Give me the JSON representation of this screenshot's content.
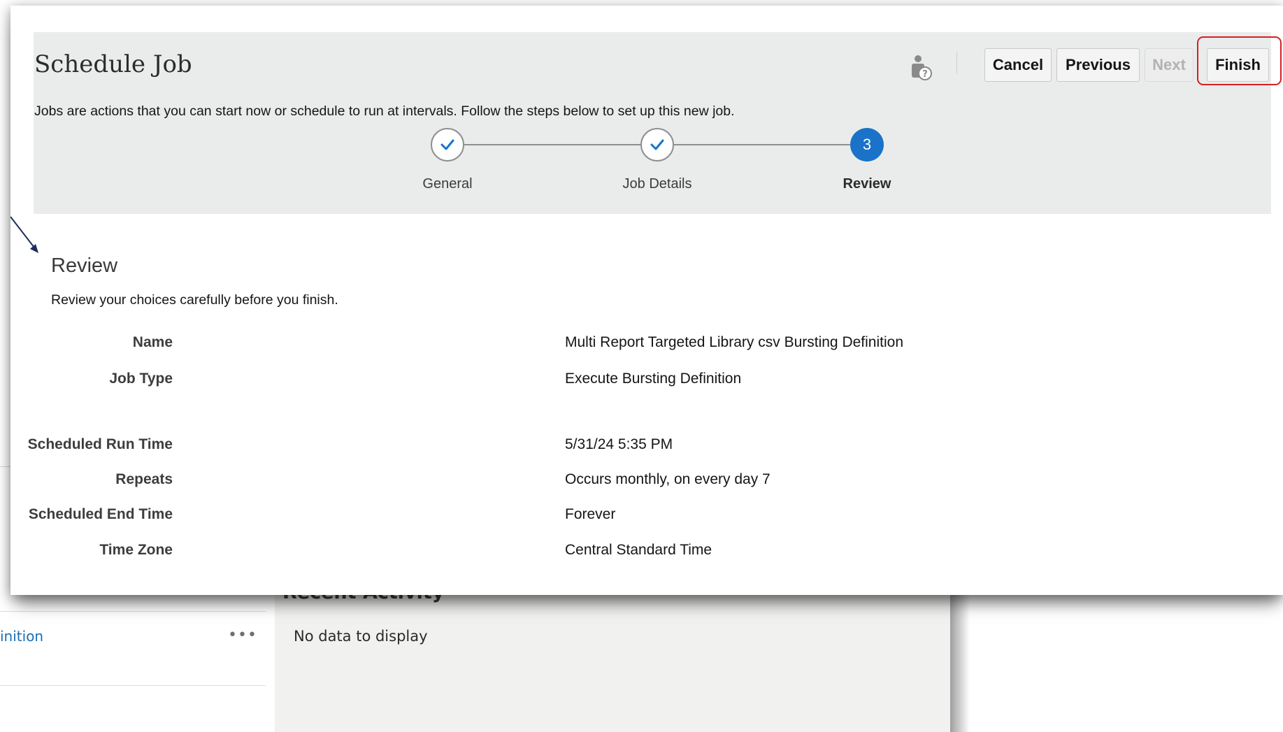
{
  "background": {
    "link_text": "inition",
    "more_icon": "more-horizontal-icon",
    "panel_title": "Recent Activity",
    "panel_empty_text": "No data to display"
  },
  "dialog": {
    "title": "Schedule Job",
    "help_icon": "person-help-icon",
    "buttons": {
      "cancel": "Cancel",
      "previous": "Previous",
      "next": "Next",
      "finish": "Finish"
    },
    "intro": "Jobs are actions that you can start now or schedule to run at intervals. Follow the steps below to set up this new job.",
    "steps": [
      {
        "label": "General",
        "state": "complete",
        "icon": "check-icon"
      },
      {
        "label": "Job Details",
        "state": "complete",
        "icon": "check-icon"
      },
      {
        "label": "Review",
        "state": "current",
        "number": "3"
      }
    ],
    "colors": {
      "accent": "#1a73c8",
      "highlight": "#d81f26",
      "header_bg": "#eaecec"
    }
  },
  "review": {
    "heading": "Review",
    "instructions": "Review your choices carefully before you finish.",
    "fields": {
      "name": {
        "label": "Name",
        "value": "Multi Report Targeted Library csv Bursting Definition"
      },
      "job_type": {
        "label": "Job Type",
        "value": "Execute Bursting Definition"
      },
      "scheduled_run_time": {
        "label": "Scheduled Run Time",
        "value": "5/31/24 5:35 PM"
      },
      "repeats": {
        "label": "Repeats",
        "value": "Occurs monthly, on every day 7"
      },
      "scheduled_end_time": {
        "label": "Scheduled End Time",
        "value": "Forever"
      },
      "time_zone": {
        "label": "Time Zone",
        "value": "Central Standard Time"
      }
    }
  }
}
